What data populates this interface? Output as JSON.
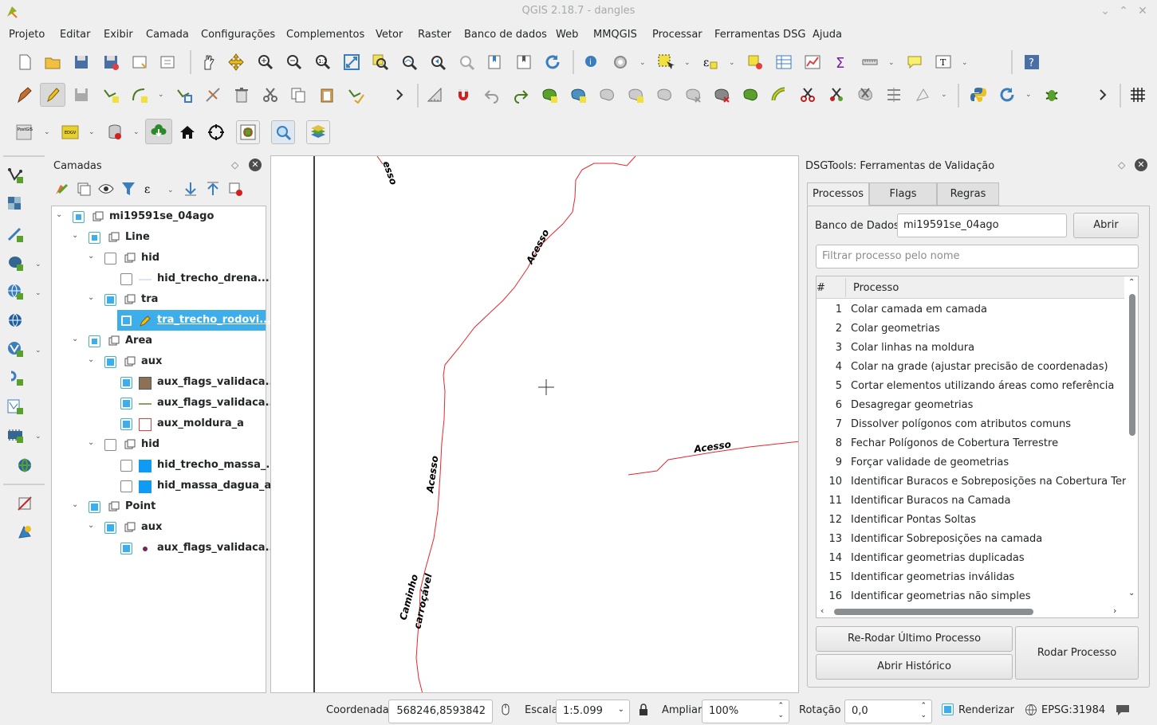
{
  "window": {
    "title": "QGIS 2.18.7 - dangles"
  },
  "menubar": [
    "Projeto",
    "Editar",
    "Exibir",
    "Camada",
    "Configurações",
    "Complementos",
    "Vetor",
    "Raster",
    "Banco de dados",
    "Web",
    "MMQGIS",
    "Processar",
    "Ferramentas DSG",
    "Ajuda"
  ],
  "layers_panel": {
    "title": "Camadas",
    "tree": [
      {
        "label": "mi19591se_04ago",
        "type": "group",
        "check": "partial"
      },
      {
        "label": "Line",
        "type": "group",
        "check": "partial"
      },
      {
        "label": "hid",
        "type": "group",
        "check": "off"
      },
      {
        "label": "hid_trecho_drena...",
        "type": "layer",
        "check": "off",
        "symbol": "line-light"
      },
      {
        "label": "tra",
        "type": "group",
        "check": "on"
      },
      {
        "label": "tra_trecho_rodovi...",
        "type": "layer",
        "check": "on",
        "symbol": "line-edit",
        "selected": true
      },
      {
        "label": "Area",
        "type": "group",
        "check": "partial"
      },
      {
        "label": "aux",
        "type": "group",
        "check": "on"
      },
      {
        "label": "aux_flags_validaca...",
        "type": "layer",
        "check": "on",
        "symbol": "fill-brown"
      },
      {
        "label": "aux_flags_validaca...",
        "type": "layer",
        "check": "on",
        "symbol": "line-olive"
      },
      {
        "label": "aux_moldura_a",
        "type": "layer",
        "check": "on",
        "symbol": "fill-outline-red"
      },
      {
        "label": "hid",
        "type": "group",
        "check": "off"
      },
      {
        "label": "hid_trecho_massa_...",
        "type": "layer",
        "check": "off",
        "symbol": "fill-blue"
      },
      {
        "label": "hid_massa_dagua_a",
        "type": "layer",
        "check": "off",
        "symbol": "fill-blue"
      },
      {
        "label": "Point",
        "type": "group",
        "check": "on"
      },
      {
        "label": "aux",
        "type": "group",
        "check": "on"
      },
      {
        "label": "aux_flags_validaca...",
        "type": "layer",
        "check": "on",
        "symbol": "point-purple"
      }
    ]
  },
  "map": {
    "labels": [
      "esso",
      "Acesso",
      "Acesso",
      "Acesso",
      "Caminho",
      "carroçável"
    ]
  },
  "dsg_panel": {
    "title": "DSGTools: Ferramentas de Validação",
    "tabs": [
      "Processos",
      "Flags",
      "Regras"
    ],
    "db_label": "Banco de Dados",
    "db_value": "mi19591se_04ago",
    "open_button": "Abrir",
    "filter_placeholder": "Filtrar processo pelo nome",
    "columns": [
      "#",
      "Processo"
    ],
    "processes": [
      [
        "1",
        "Colar camada em camada"
      ],
      [
        "2",
        "Colar geometrias"
      ],
      [
        "3",
        "Colar linhas na moldura"
      ],
      [
        "4",
        "Colar na grade (ajustar precisão de coordenadas)"
      ],
      [
        "5",
        "Cortar elementos utilizando áreas como referência"
      ],
      [
        "6",
        "Desagregar geometrias"
      ],
      [
        "7",
        "Dissolver polígonos com atributos comuns"
      ],
      [
        "8",
        "Fechar Polígonos de Cobertura Terrestre"
      ],
      [
        "9",
        "Forçar validade de geometrias"
      ],
      [
        "10",
        "Identificar Buracos e Sobreposições na Cobertura Terrest"
      ],
      [
        "11",
        "Identificar Buracos na Camada"
      ],
      [
        "12",
        "Identificar Pontas Soltas"
      ],
      [
        "13",
        "Identificar Sobreposições na camada"
      ],
      [
        "14",
        "Identificar geometrias duplicadas"
      ],
      [
        "15",
        "Identificar geometrias inválidas"
      ],
      [
        "16",
        "Identificar geometrias não simples"
      ]
    ],
    "rerun_button": "Re-Rodar Último Processo",
    "history_button": "Abrir Histórico",
    "run_button": "Rodar Processo"
  },
  "statusbar": {
    "coord_label": "Coordenada",
    "coord_value": "568246,8593842",
    "scale_label": "Escala",
    "scale_value": "1:5.099",
    "zoom_label": "Ampliar",
    "zoom_value": "100%",
    "rotation_label": "Rotação",
    "rotation_value": "0,0",
    "render_label": "Renderizar",
    "crs": "EPSG:31984"
  },
  "colors": {
    "accent": "#3daee9",
    "road": "#e8262b",
    "frame": "#000000"
  }
}
